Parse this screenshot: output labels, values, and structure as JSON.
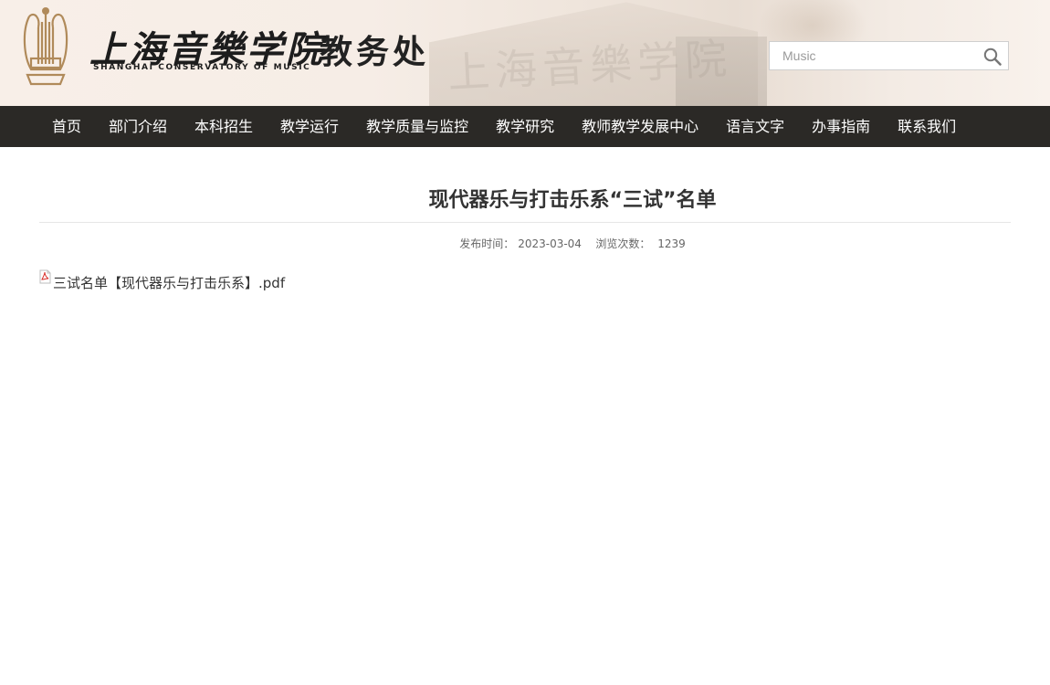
{
  "header": {
    "school_name_cn": "上海音樂学院",
    "school_name_en": "SHANGHAI CONSERVATORY OF MUSIC",
    "office_name": "教务处",
    "search_placeholder": "Music",
    "search_icon": "magnifier-icon",
    "bg_text": "上海音樂学院"
  },
  "nav": {
    "items": [
      "首页",
      "部门介绍",
      "本科招生",
      "教学运行",
      "教学质量与监控",
      "教学研究",
      "教师教学发展中心",
      "语言文字",
      "办事指南",
      "联系我们"
    ]
  },
  "article": {
    "title": "现代器乐与打击乐系“三试”名单",
    "publish_label": "发布时间：",
    "publish_date": "2023-03-04",
    "views_label": "浏览次数：",
    "views_count": "1239",
    "attachment": {
      "icon": "pdf-icon",
      "name": "三试名单【现代器乐与打击乐系】.pdf"
    }
  },
  "colors": {
    "nav_bg": "#2b2926",
    "header_bg": "#f6ede6",
    "logo_gold": "#b08a5a"
  }
}
